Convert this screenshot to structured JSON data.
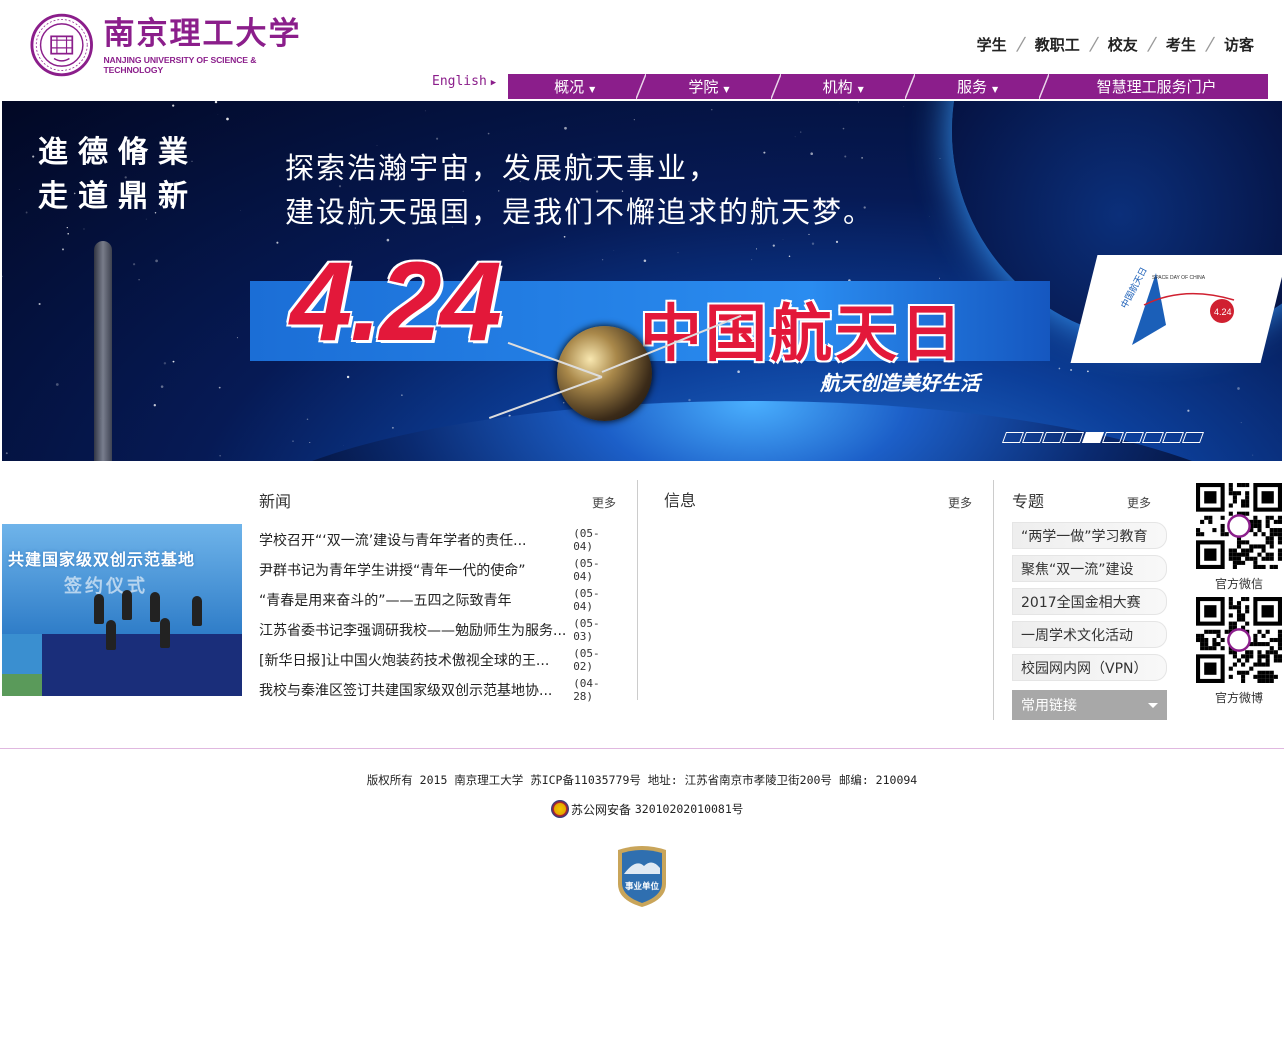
{
  "brand": {
    "name_cn": "南京理工大学",
    "name_en": "NANJING UNIVERSITY OF SCIENCE & TECHNOLOGY",
    "color": "#8b1e8b"
  },
  "user_links": [
    "学生",
    "教职工",
    "校友",
    "考生",
    "访客"
  ],
  "language_link": "English",
  "nav": {
    "items": [
      {
        "label": "概况",
        "has_dropdown": true
      },
      {
        "label": "学院",
        "has_dropdown": true
      },
      {
        "label": "机构",
        "has_dropdown": true
      },
      {
        "label": "服务",
        "has_dropdown": true
      },
      {
        "label": "智慧理工服务门户",
        "has_dropdown": false
      }
    ]
  },
  "banner": {
    "calligraphy_line1": "進德脩業",
    "calligraphy_line2": "走道鼎新",
    "slogan_line1": "探索浩瀚宇宙，发展航天事业，",
    "slogan_line2": "建设航天强国，是我们不懈追求的航天梦。",
    "date": "4.24",
    "day_name": "中国航天日",
    "sub_slogan": "航天创造美好生活",
    "logo_text": "中国航天日",
    "logo_en": "SPACE DAY OF CHINA",
    "logo_badge": "4.24",
    "slides_total": 10,
    "active_slide": 5
  },
  "news": {
    "title": "新闻",
    "more": "更多",
    "photo_caption_line1": "共建国家级双创示范基地",
    "photo_caption_line2": "签约仪式",
    "items": [
      {
        "title": "学校召开“‘双一流’建设与青年学者的责任...",
        "date": "(05-04)"
      },
      {
        "title": "尹群书记为青年学生讲授“青年一代的使命”",
        "date": "(05-04)"
      },
      {
        "title": "“青春是用来奋斗的”——五四之际致青年",
        "date": "(05-04)"
      },
      {
        "title": "江苏省委书记李强调研我校——勉励师生为服务...",
        "date": "(05-03)"
      },
      {
        "title": "[新华日报]让中国火炮装药技术傲视全球的王...",
        "date": "(05-02)"
      },
      {
        "title": "我校与秦淮区签订共建国家级双创示范基地协...",
        "date": "(04-28)"
      }
    ]
  },
  "info": {
    "title": "信息",
    "more": "更多"
  },
  "topics": {
    "title": "专题",
    "more": "更多",
    "items": [
      "“两学一做”学习教育",
      "聚焦“双一流”建设",
      "2017全国金相大赛",
      "一周学术文化活动",
      "校园网内网（VPN）"
    ],
    "select_label": "常用链接"
  },
  "qr": {
    "wechat_label": "官方微信",
    "weibo_label": "官方微博"
  },
  "footer": {
    "copyright": "版权所有 2015 南京理工大学 苏ICP备11035779号 地址: 江苏省南京市孝陵卫街200号 邮编: 210094",
    "police_prefix": "苏公网安备",
    "police_number": "32010202010081号",
    "shield_text": "事业单位"
  }
}
